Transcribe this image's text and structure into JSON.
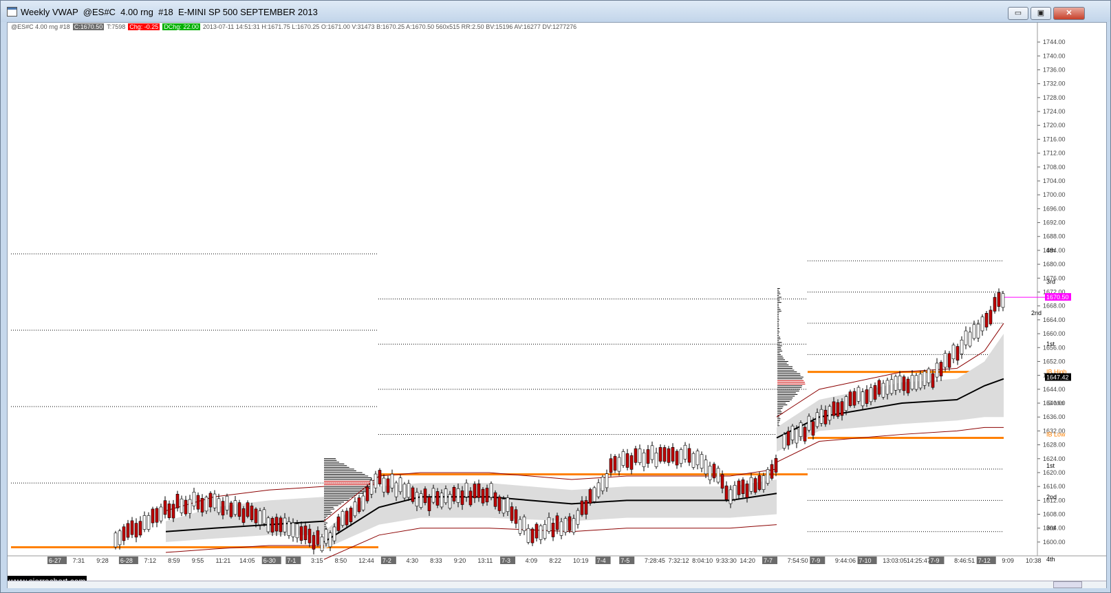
{
  "window": {
    "title": "Weekly VWAP  @ES#C  4.00 rng  #18  E-MINI SP 500 SEPTEMBER 2013",
    "minimize_glyph": "▭",
    "maximize_glyph": "▣",
    "close_glyph": "✕"
  },
  "info_bar": {
    "symbol": "@ES#C  4.00 rng  #18",
    "close": "C:1670.50",
    "trades": "T:7598",
    "change": "Chg: -0.25",
    "daily_change": "DChg: 22.00",
    "details": "2013-07-11 14:51:31  H:1671.75  L:1670.25  O:1671.00  V:31473  B:1670.25  A:1670.50  560x515  RR:2.50  BV:15196  AV:16277  DV:1277276",
    "colors": {
      "close_box": "#6b6b6b",
      "change_box": "#ff0000",
      "dchange_box": "#00b000"
    }
  },
  "price_axis": {
    "ticks": [
      "1744.00",
      "1740.00",
      "1736.00",
      "1732.00",
      "1728.00",
      "1724.00",
      "1720.00",
      "1716.00",
      "1712.00",
      "1708.00",
      "1704.00",
      "1700.00",
      "1696.00",
      "1692.00",
      "1688.00",
      "1684.00",
      "1680.00",
      "1676.00",
      "1672.00",
      "1668.00",
      "1664.00",
      "1660.00",
      "1656.00",
      "1652.00",
      "1648.00",
      "1644.00",
      "1640.00",
      "1636.00",
      "1632.00",
      "1628.00",
      "1624.00",
      "1620.00",
      "1616.00",
      "1612.00",
      "1608.00",
      "1604.00",
      "1600.00"
    ],
    "last_price_label": "1670.50",
    "vwap_label": "1647.42",
    "level_labels": [
      "4th",
      "3rd",
      "2nd",
      "1st",
      "IB High",
      "IB Mid",
      "IB Low",
      "1st",
      "2nd",
      "3rd",
      "4th"
    ],
    "colors": {
      "last": "#ff00ff",
      "vwap": "#000000",
      "ib": "#ff8000"
    }
  },
  "time_axis": {
    "labels": [
      "6-27",
      "7:31",
      "9:28",
      "6-28",
      "7:12",
      "8:59",
      "9:55",
      "11:21",
      "14:05",
      "6-30",
      "7-1",
      "3:15",
      "8:50",
      "12:44",
      "7-2",
      "4:30",
      "8:33",
      "9:20",
      "13:11",
      "7-3",
      "4:09",
      "8:22",
      "10:19",
      "7-4",
      "7-5",
      "7:28:45",
      "7:32:12",
      "8:04:10",
      "9:33:30",
      "14:20",
      "7-7",
      "7:54:50",
      "7-9",
      "9:44:06",
      "7-10",
      "13:03:05",
      "14:25:47",
      "7-9",
      "8:46:51",
      "7-12",
      "9:09",
      "10:38"
    ]
  },
  "watermark": "www.sierrachart.com",
  "chart_data": {
    "type": "candlestick",
    "title": "Weekly VWAP  @ES#C  4.00 rng  #18  E-MINI SP 500 SEPTEMBER 2013",
    "ylim": [
      1598,
      1746
    ],
    "last_price": 1670.5,
    "vwap": 1647.42,
    "ib_levels": {
      "high": 1649,
      "mid": 1640,
      "low": 1631
    }
  }
}
